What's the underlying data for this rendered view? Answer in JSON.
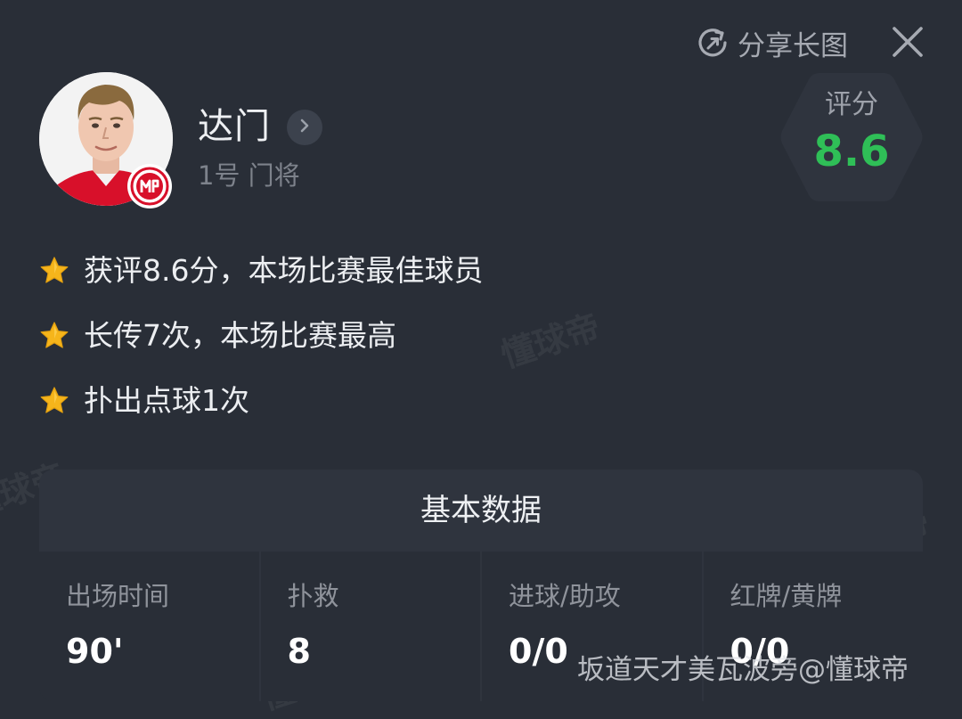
{
  "header": {
    "share_label": "分享长图",
    "share_icon": "share-refresh-icon",
    "close_icon": "close-icon"
  },
  "player": {
    "name": "达门",
    "meta": "1号 门将",
    "avatar_icon": "player-avatar",
    "club_badge_icon": "club-badge-icon",
    "chevron_icon": "chevron-right-icon"
  },
  "rating": {
    "label": "评分",
    "value": "8.6",
    "color": "#2fbf57"
  },
  "highlights": [
    {
      "icon": "star-icon",
      "text": "获评8.6分，本场比赛最佳球员"
    },
    {
      "icon": "star-icon",
      "text": "长传7次，本场比赛最高"
    },
    {
      "icon": "star-icon",
      "text": "扑出点球1次"
    }
  ],
  "stats": {
    "title": "基本数据",
    "items": [
      {
        "label": "出场时间",
        "value": "90'"
      },
      {
        "label": "扑救",
        "value": "8"
      },
      {
        "label": "进球/助攻",
        "value": "0/0"
      },
      {
        "label": "红牌/黄牌",
        "value": "0/0"
      }
    ]
  },
  "watermark": "懂球帝",
  "credit": "坂道天才美瓦波旁@懂球帝",
  "colors": {
    "background": "#292e37",
    "card": "#2f343e",
    "accent_green": "#2fbf57",
    "star": "#f6b51b"
  }
}
